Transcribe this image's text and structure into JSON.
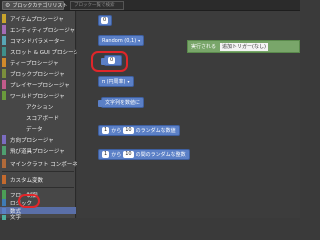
{
  "toolbar": {
    "dropdown_label": "ブロックカテゴリリスト",
    "search_placeholder": "ブロック一覧で検索"
  },
  "sidebar": {
    "items": [
      {
        "label": "アイテムプロシージャ",
        "color": "#c9a52c"
      },
      {
        "label": "エンティティプロシージャ",
        "color": "#a36bb5"
      },
      {
        "label": "コマンドパラメーター",
        "color": "#58a6b5"
      },
      {
        "label": "スロット & GUI プロシージャ",
        "color": "#3f8f8a"
      },
      {
        "label": "ティープロシージャ",
        "color": "#d08a2c"
      },
      {
        "label": "ブロックプロシージャ",
        "color": "#7b8f3c"
      },
      {
        "label": "プレイヤープロシージャ",
        "color": "#c25b8a"
      },
      {
        "label": "ワールドプロシージャ",
        "color": "#6a9a3c"
      },
      {
        "label": "アクション",
        "sub": true
      },
      {
        "label": "スコアボード",
        "sub": true
      },
      {
        "label": "データ",
        "sub": true
      },
      {
        "label": "方向プロシージャ",
        "color": "#7b6cc0"
      },
      {
        "label": "飛び道具プロシージャ",
        "color": "#4f9f6f"
      },
      {
        "label": "マインクラフト コンポーネント",
        "color": "#b06a3a"
      },
      {
        "label": "カスタム変数",
        "color": "#c46a2e"
      },
      {
        "label": "フロー制御",
        "color": "#4c9f56"
      },
      {
        "label": "ロジック",
        "color": "#3f7bb5"
      },
      {
        "label": "数式",
        "color": "#5b80c7"
      },
      {
        "label": "文字",
        "color": "#4caf9f"
      }
    ],
    "active": "数式"
  },
  "blocks": {
    "num0": "0",
    "random": "Random (0,1)",
    "selected_num": "0",
    "number_type": "π (円周率)",
    "to_number": "文字列を数値に",
    "rand_int_label": "のランダムな数値",
    "rand_float_label": "の間のランダムな整数",
    "from_a": "1",
    "to_word": "から",
    "to_b": "10",
    "from_c": "1",
    "to_d": "10"
  },
  "green_block": {
    "label": "実行される",
    "inner": "追加トリガー(なし)"
  }
}
